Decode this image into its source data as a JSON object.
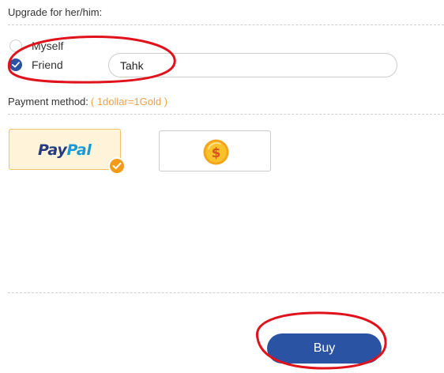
{
  "upgrade": {
    "title": "Upgrade for her/him:",
    "options": [
      {
        "label": "Myself",
        "selected": false
      },
      {
        "label": "Friend",
        "selected": true
      }
    ],
    "friend_name_value": "Tahk"
  },
  "payment": {
    "label": "Payment method:",
    "rate": "( 1dollar=1Gold )",
    "methods": [
      {
        "name": "PayPal",
        "logo_pay": "Pay",
        "logo_pal": "Pal",
        "selected": true,
        "icon": "paypal-logo"
      },
      {
        "name": "Gold",
        "selected": false,
        "icon": "gold-coin-icon"
      }
    ]
  },
  "actions": {
    "buy_label": "Buy"
  },
  "colors": {
    "accent_blue": "#2b53a3",
    "rate_orange": "#f0a04b",
    "selected_bg": "#fff3d9",
    "check_orange": "#f39a1b",
    "annotation_red": "#e0121b"
  }
}
